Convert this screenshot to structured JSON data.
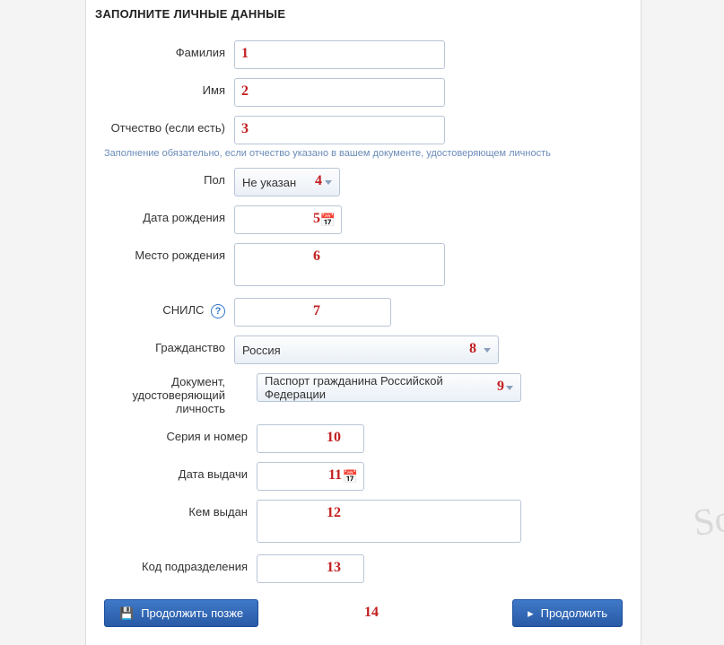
{
  "section_title": "ЗАПОЛНИТЕ ЛИЧНЫЕ ДАННЫЕ",
  "labels": {
    "lastname": "Фамилия",
    "firstname": "Имя",
    "patronymic": "Отчество (если есть)",
    "gender": "Пол",
    "dob": "Дата рождения",
    "pob": "Место рождения",
    "snils": "СНИЛС",
    "citizenship": "Гражданство",
    "doc_type": "Документ, удостоверяющий личность",
    "series_no": "Серия и номер",
    "issue_date": "Дата выдачи",
    "issued_by": "Кем выдан",
    "dept_code": "Код подразделения"
  },
  "helper_patronymic": "Заполнение обязательно, если отчество указано в вашем документе, удостоверяющем личность",
  "values": {
    "gender_selected": "Не указан",
    "citizenship_selected": "Россия",
    "doc_selected": "Паспорт гражданина Российской Федерации"
  },
  "buttons": {
    "save_later": "Продолжить позже",
    "continue": "Продолжить"
  },
  "annotations": {
    "n1": "1",
    "n2": "2",
    "n3": "3",
    "n4": "4",
    "n5": "5",
    "n6": "6",
    "n7": "7",
    "n8": "8",
    "n9": "9",
    "n10": "10",
    "n11": "11",
    "n12": "12",
    "n13": "13",
    "n14": "14"
  },
  "watermark": "So"
}
